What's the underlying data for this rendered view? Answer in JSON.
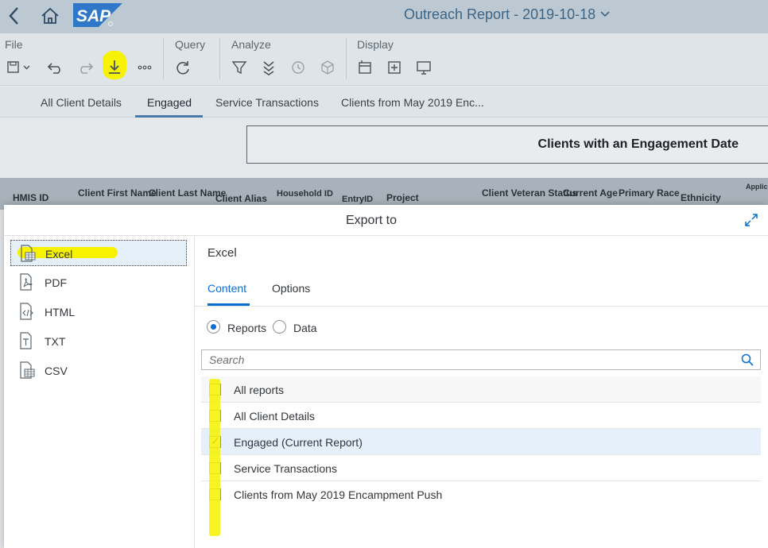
{
  "shell": {
    "logo_text": "SAP",
    "title": "Outreach Report - 2019-10-18"
  },
  "toolbar": {
    "groups": {
      "file": "File",
      "query": "Query",
      "analyze": "Analyze",
      "display": "Display"
    },
    "icons": [
      "save-icon",
      "undo-icon",
      "redo-icon",
      "download-icon",
      "more-icon",
      "refresh-icon",
      "filter-icon",
      "drill-icon",
      "history-icon",
      "cube-icon",
      "panel-icon",
      "insert-icon",
      "monitor-icon"
    ]
  },
  "report_tabs": [
    {
      "label": "All Client Details"
    },
    {
      "label": "Engaged"
    },
    {
      "label": "Service Transactions"
    },
    {
      "label": "Clients from May 2019 Enc..."
    }
  ],
  "report": {
    "title": "Clients with an Engagement Date",
    "columns": [
      "HMIS ID",
      "Client First Name",
      "Client Last Name",
      "Client Alias",
      "Household ID",
      "EntryID",
      "Project",
      "Client Veteran Status",
      "Current Age",
      "Primary Race",
      "Ethnicity",
      "Applic Foun Enca"
    ]
  },
  "dialog": {
    "title": "Export to",
    "formats": [
      {
        "label": "Excel",
        "icon": "excel-file-icon"
      },
      {
        "label": "PDF",
        "icon": "pdf-file-icon"
      },
      {
        "label": "HTML",
        "icon": "html-file-icon"
      },
      {
        "label": "TXT",
        "icon": "txt-file-icon"
      },
      {
        "label": "CSV",
        "icon": "csv-file-icon"
      }
    ],
    "pane_title": "Excel",
    "tabs": {
      "content": "Content",
      "options": "Options"
    },
    "radios": {
      "reports": "Reports",
      "data": "Data"
    },
    "search_placeholder": "Search",
    "reports": [
      {
        "label": "All reports",
        "checked": false
      },
      {
        "label": "All Client Details",
        "checked": false
      },
      {
        "label": "Engaged (Current Report)",
        "checked": true
      },
      {
        "label": "Service Transactions",
        "checked": false
      },
      {
        "label": "Clients from May 2019 Encampment Push",
        "checked": false
      }
    ]
  },
  "colors": {
    "highlight": "#f6f200",
    "accent": "#0a6ed1",
    "shell_bg": "#bcc8d2"
  }
}
